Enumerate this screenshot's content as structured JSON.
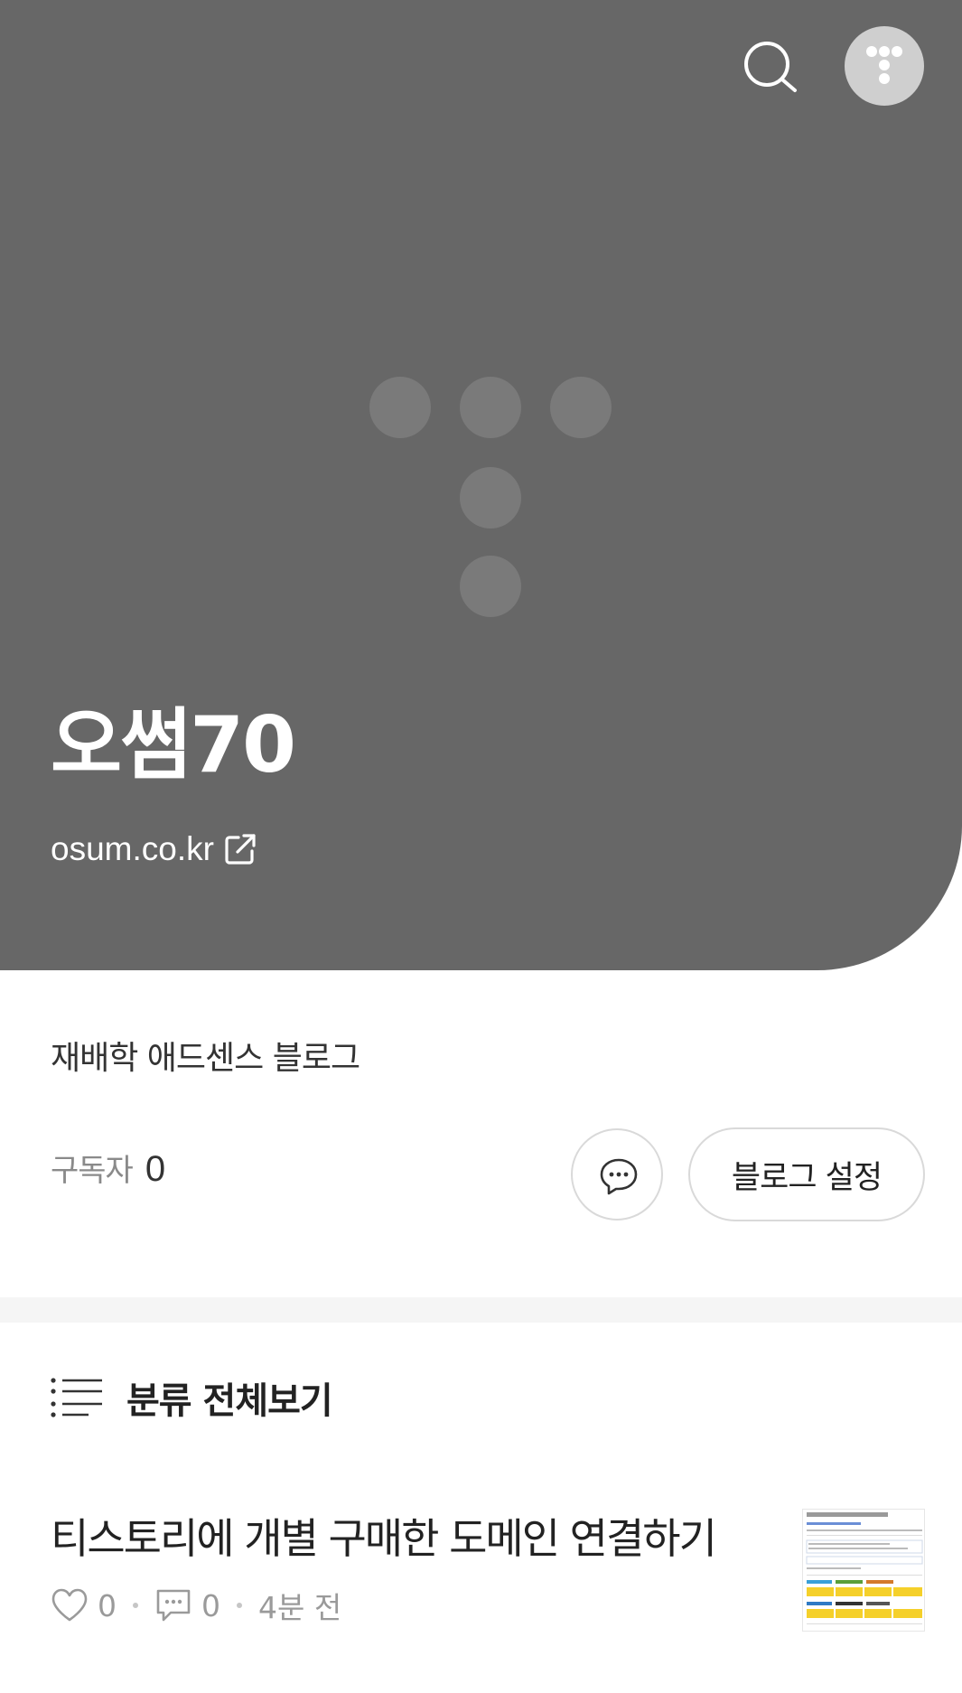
{
  "header": {
    "search_icon": "search-icon",
    "menu_icon": "tistory-menu-icon"
  },
  "hero": {
    "background_color": "#676767",
    "logo_icon": "tistory-logo-icon",
    "blog_name": "오썸70",
    "blog_url": "osum.co.kr",
    "external_link_icon": "external-link-icon"
  },
  "profile": {
    "description": "재배학 애드센스 블로그",
    "subscriber_label": "구독자",
    "subscriber_count": "0",
    "chat_icon": "chat-bubble-icon",
    "settings_label": "블로그 설정"
  },
  "category": {
    "icon": "list-icon",
    "label": "분류 전체보기"
  },
  "posts": [
    {
      "title": "티스토리에 개별 구매한 도메인 연결하기",
      "likes": "0",
      "comments": "0",
      "time": "4분 전"
    }
  ]
}
